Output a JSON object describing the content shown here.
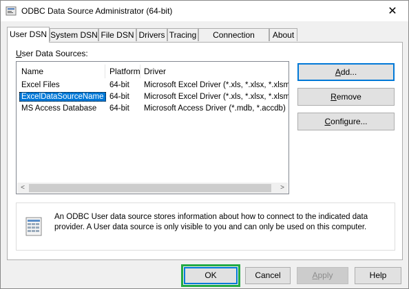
{
  "window": {
    "title": "ODBC Data Source Administrator (64-bit)",
    "close_glyph": "✕"
  },
  "tabs": [
    {
      "label": "User DSN",
      "active": true
    },
    {
      "label": "System DSN"
    },
    {
      "label": "File DSN"
    },
    {
      "label": "Drivers"
    },
    {
      "label": "Tracing"
    },
    {
      "label": "Connection Pooling"
    },
    {
      "label": "About"
    }
  ],
  "user_dsn": {
    "section_label_u": "U",
    "section_label_rest": "ser Data Sources:",
    "columns": [
      "Name",
      "Platform",
      "Driver"
    ],
    "rows": [
      {
        "name": "Excel Files",
        "platform": "64-bit",
        "driver": "Microsoft Excel Driver (*.xls, *.xlsx, *.xlsm, *.xl"
      },
      {
        "name": "ExcelDataSourceName",
        "platform": "64-bit",
        "driver": "Microsoft Excel Driver (*.xls, *.xlsx, *.xlsm, *.xl",
        "selected": true
      },
      {
        "name": "MS Access Database",
        "platform": "64-bit",
        "driver": "Microsoft Access Driver (*.mdb, *.accdb)"
      }
    ],
    "scroll_left": "<",
    "scroll_right": ">",
    "buttons": {
      "add_u": "A",
      "add_rest": "dd...",
      "remove_u": "R",
      "remove_rest": "emove",
      "configure_u": "C",
      "configure_rest": "onfigure..."
    },
    "info_text": "An ODBC User data source stores information about how to connect to the indicated data provider.   A User data source is only visible to you and can only be used on this computer."
  },
  "footer": {
    "ok": "OK",
    "cancel": "Cancel",
    "apply_u": "A",
    "apply_rest": "pply",
    "help": "Help"
  },
  "colors": {
    "selection": "#0078d7",
    "highlight_box": "#22aa44"
  }
}
